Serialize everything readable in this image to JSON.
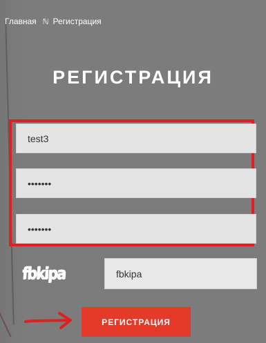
{
  "breadcrumb": {
    "home_label": "Главная",
    "separator": "ℕ",
    "current_label": "Регистрация"
  },
  "page": {
    "title": "РЕГИСТРАЦИЯ"
  },
  "form": {
    "username_value": "test3",
    "password_value": "•••••••",
    "password_confirm_value": "•••••••",
    "captcha_image_text": "fbkipa",
    "captcha_value": "fbkipa",
    "submit_label": "РЕГИСТРАЦИЯ"
  },
  "colors": {
    "background": "#7c7c7c",
    "accent": "#e53a2a",
    "highlight": "#e02020",
    "field": "#e4e4e4"
  },
  "icons": {
    "arrow": "arrow-right-icon"
  }
}
